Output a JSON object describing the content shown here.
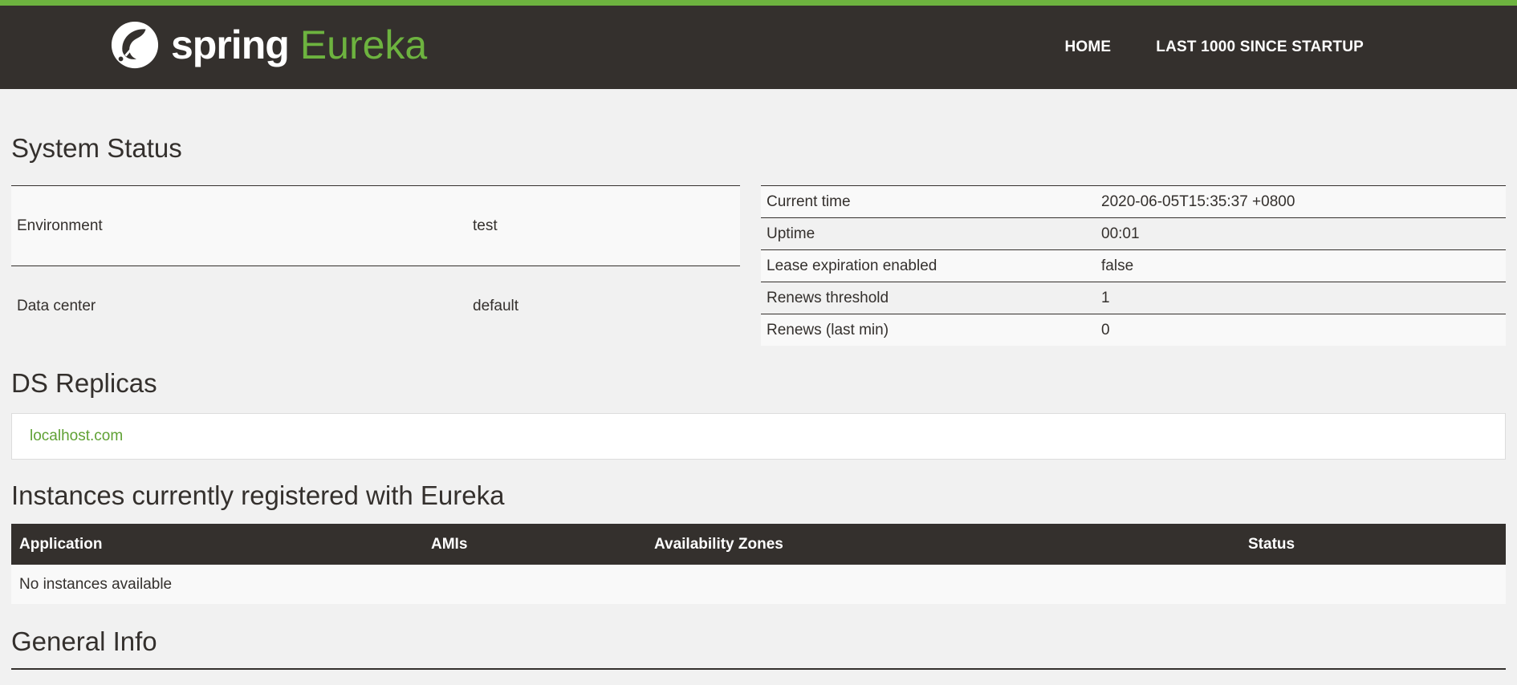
{
  "header": {
    "brand_spring": "spring",
    "brand_eureka": "Eureka",
    "nav": [
      {
        "label": "HOME"
      },
      {
        "label": "LAST 1000 SINCE STARTUP"
      }
    ]
  },
  "colors": {
    "accent": "#6db33f",
    "navbar": "#34302d",
    "background": "#f1f1f1"
  },
  "system_status": {
    "title": "System Status",
    "left": [
      {
        "key": "Environment",
        "value": "test"
      },
      {
        "key": "Data center",
        "value": "default"
      }
    ],
    "right": [
      {
        "key": "Current time",
        "value": "2020-06-05T15:35:37 +0800"
      },
      {
        "key": "Uptime",
        "value": "00:01"
      },
      {
        "key": "Lease expiration enabled",
        "value": "false"
      },
      {
        "key": "Renews threshold",
        "value": "1"
      },
      {
        "key": "Renews (last min)",
        "value": "0"
      }
    ]
  },
  "ds_replicas": {
    "title": "DS Replicas",
    "items": [
      {
        "label": "localhost.com"
      }
    ]
  },
  "instances": {
    "title": "Instances currently registered with Eureka",
    "columns": [
      "Application",
      "AMIs",
      "Availability Zones",
      "Status"
    ],
    "empty_text": "No instances available"
  },
  "general_info": {
    "title": "General Info"
  }
}
